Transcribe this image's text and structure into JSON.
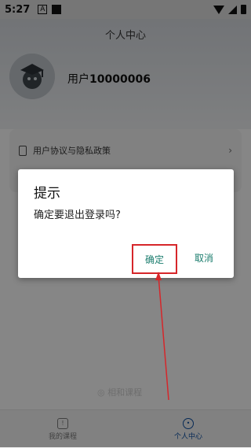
{
  "status_bar": {
    "time": "5:27",
    "icon_a": "A"
  },
  "page": {
    "title": "个人中心"
  },
  "profile": {
    "prefix": "用户",
    "id": "10000006"
  },
  "menu": {
    "items": [
      {
        "label": "用户协议与隐私政策",
        "icon": "document-icon"
      }
    ]
  },
  "watermark": "◎ 相和课程",
  "tabs": [
    {
      "label": "我的课程",
      "icon": "course-icon",
      "active": false
    },
    {
      "label": "个人中心",
      "icon": "profile-icon",
      "active": true
    }
  ],
  "dialog": {
    "title": "提示",
    "message": "确定要退出登录吗?",
    "confirm_label": "确定",
    "cancel_label": "取消"
  },
  "colors": {
    "accent": "#1b7d6e",
    "highlight": "#d6262a",
    "tab_active": "#0b4b9c"
  }
}
